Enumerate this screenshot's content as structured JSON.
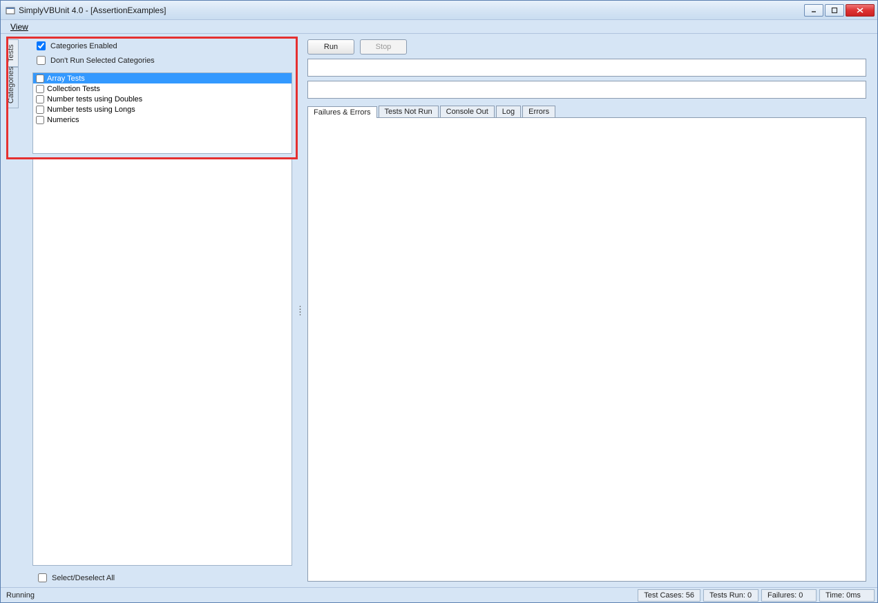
{
  "window": {
    "title": "SimplyVBUnit 4.0 - [AssertionExamples]"
  },
  "menu": {
    "view": "View"
  },
  "sidetabs": {
    "tests": "Tests",
    "categories": "Categories"
  },
  "categories_panel": {
    "enabled_label": "Categories Enabled",
    "enabled_checked": true,
    "dont_run_label": "Don't Run Selected Categories",
    "dont_run_checked": false,
    "items": [
      {
        "label": "Array Tests",
        "checked": false,
        "selected": true
      },
      {
        "label": "Collection Tests",
        "checked": false,
        "selected": false
      },
      {
        "label": "Number tests using Doubles",
        "checked": false,
        "selected": false
      },
      {
        "label": "Number tests using Longs",
        "checked": false,
        "selected": false
      },
      {
        "label": "Numerics",
        "checked": false,
        "selected": false
      }
    ],
    "select_all_label": "Select/Deselect All"
  },
  "toolbar": {
    "run_label": "Run",
    "stop_label": "Stop"
  },
  "result_tabs": {
    "failures": "Failures & Errors",
    "not_run": "Tests Not Run",
    "console": "Console Out",
    "log": "Log",
    "errors": "Errors"
  },
  "status": {
    "left": "Running",
    "test_cases": "Test Cases: 56",
    "tests_run": "Tests Run: 0",
    "failures": "Failures: 0",
    "time": "Time: 0ms"
  }
}
